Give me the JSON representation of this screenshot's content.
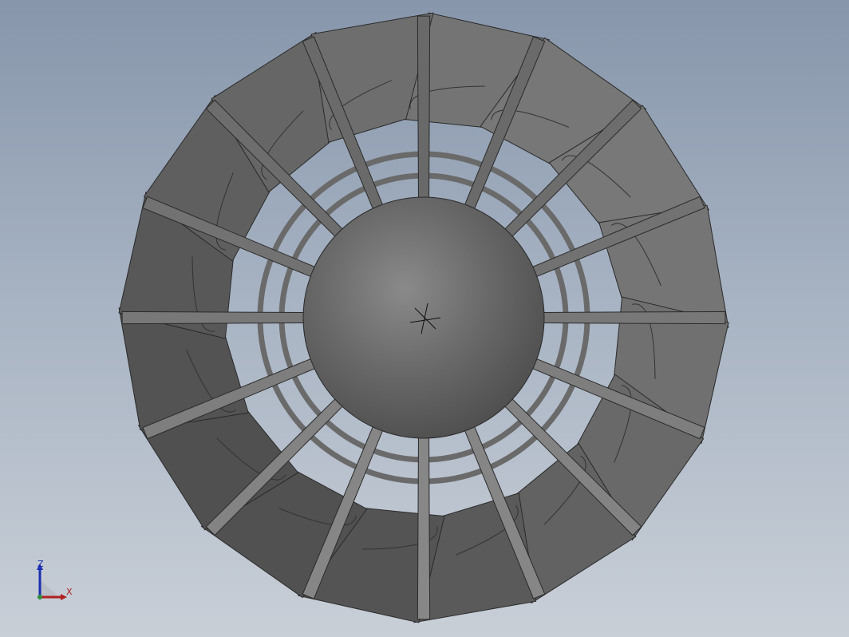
{
  "viewport": {
    "background_top": "#8796ab",
    "background_bottom": "#c9cfd7"
  },
  "model": {
    "blade_count": 16,
    "blade_color": "#6f6f6f",
    "blade_edge_color": "#2a2a2a",
    "hub_color": "#5e5e5e",
    "ring_color": "#6a6a6a"
  },
  "triad": {
    "z_label": "Z",
    "x_label": "X",
    "z_color": "#1a2fb0",
    "x_color": "#b02020"
  }
}
